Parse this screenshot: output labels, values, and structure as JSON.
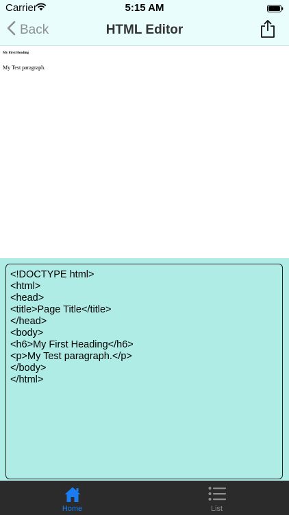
{
  "status_bar": {
    "carrier": "Carrier",
    "time": "5:15 AM"
  },
  "nav_bar": {
    "back_label": "Back",
    "title": "HTML Editor",
    "share_icon": "share-icon"
  },
  "preview": {
    "heading": "My First Heading",
    "paragraph": "My Test paragraph."
  },
  "editor": {
    "content": "<!DOCTYPE html>\n<html>\n<head>\n<title>Page Title</title>\n</head>\n<body>\n<h6>My First Heading</h6>\n<p>My Test paragraph.</p>\n</body>\n</html>"
  },
  "tab_bar": {
    "home_label": "Home",
    "list_label": "List",
    "active_color": "#1a7cf0",
    "inactive_color": "#8e8e93"
  },
  "colors": {
    "nav_background": "#e9fdfd",
    "editor_background": "#aeece5",
    "tab_bar_background": "#2b2b2b"
  }
}
